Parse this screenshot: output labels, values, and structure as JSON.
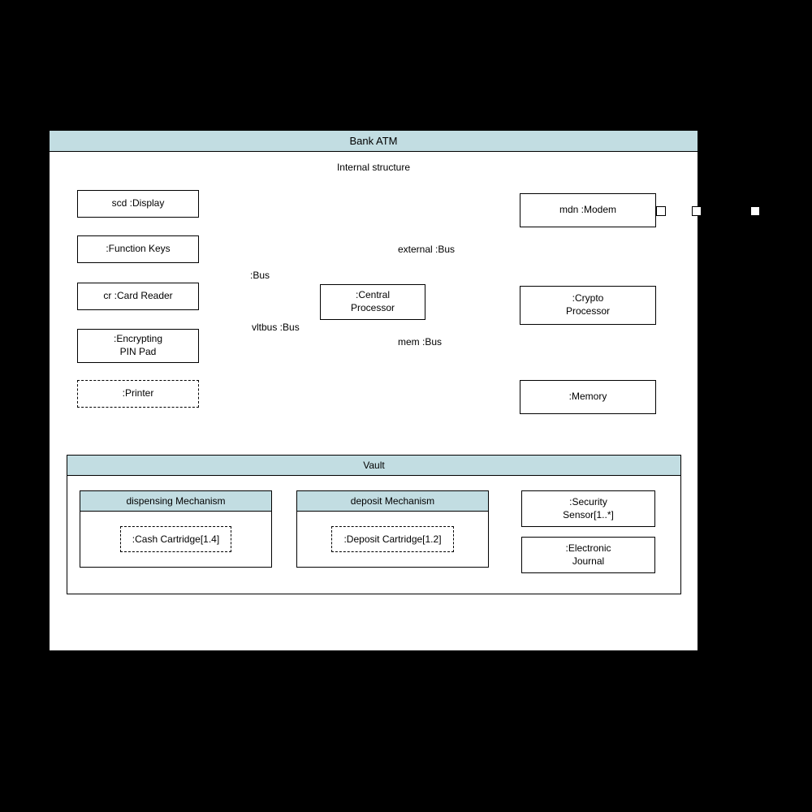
{
  "main": {
    "title": "Bank ATM",
    "subtitle": "Internal structure"
  },
  "boxes": {
    "display": "scd :Display",
    "functionKeys": ":Function Keys",
    "cardReader": "cr :Card Reader",
    "pinPad": ":Encrypting\nPIN Pad",
    "printer": ":Printer",
    "central": ":Central\nProcessor",
    "modem": "mdn :Modem",
    "crypto": ":Crypto\nProcessor",
    "memory": ":Memory"
  },
  "labels": {
    "bus": ":Bus",
    "vltbus": "vltbus :Bus",
    "external": "external :Bus",
    "mem": "mem :Bus"
  },
  "vault": {
    "title": "Vault",
    "dispensing": {
      "title": "dispensing Mechanism",
      "cartridge": ":Cash Cartridge[1.4]"
    },
    "deposit": {
      "title": "deposit Mechanism",
      "cartridge": ":Deposit Cartridge[1.2]"
    },
    "security": ":Security\nSensor[1..*]",
    "journal": ":Electronic\nJournal"
  }
}
